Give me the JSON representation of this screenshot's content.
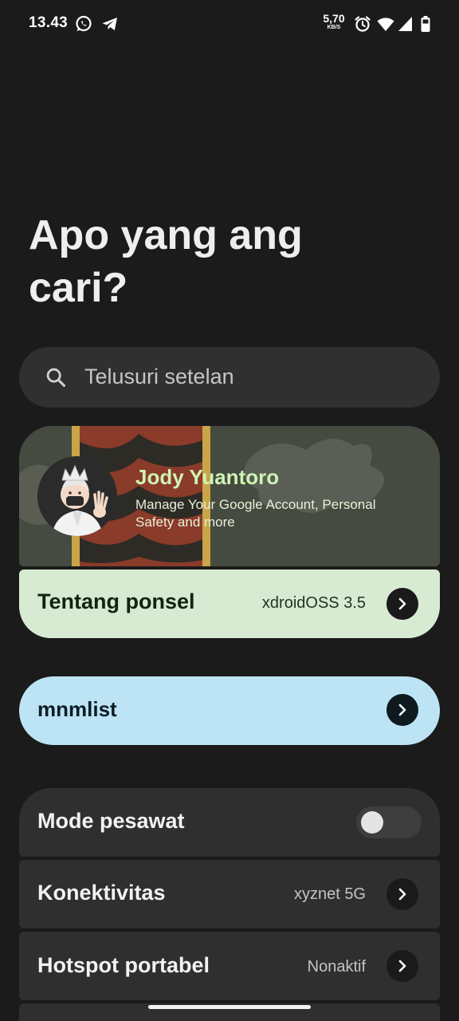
{
  "status_bar": {
    "time": "13.43",
    "speed_value": "5,70",
    "speed_unit": "KB/S",
    "icons": [
      "whatsapp-icon",
      "telegram-icon",
      "alarm-icon",
      "wifi-icon",
      "signal-icon",
      "battery-icon"
    ]
  },
  "heading": "Apo yang ang cari?",
  "search": {
    "placeholder": "Telusuri setelan"
  },
  "account": {
    "name": "Jody Yuantoro",
    "subtitle": "Manage Your Google Account, Personal Safety and more"
  },
  "about_phone": {
    "label": "Tentang ponsel",
    "value": "xdroidOSS 3.5"
  },
  "mnmlist": {
    "label": "mnmlist"
  },
  "settings": {
    "airplane": {
      "label": "Mode pesawat",
      "enabled": false
    },
    "connectivity": {
      "label": "Konektivitas",
      "value": "xyznet 5G"
    },
    "hotspot": {
      "label": "Hotspot portabel",
      "value": "Nonaktif"
    }
  },
  "colors": {
    "background": "#1b1b1b",
    "account_name": "#cdf3b3",
    "about_card": "#d6ebd2",
    "mnmlist_card": "#bde4f4",
    "list_card": "#2f2f2f"
  }
}
